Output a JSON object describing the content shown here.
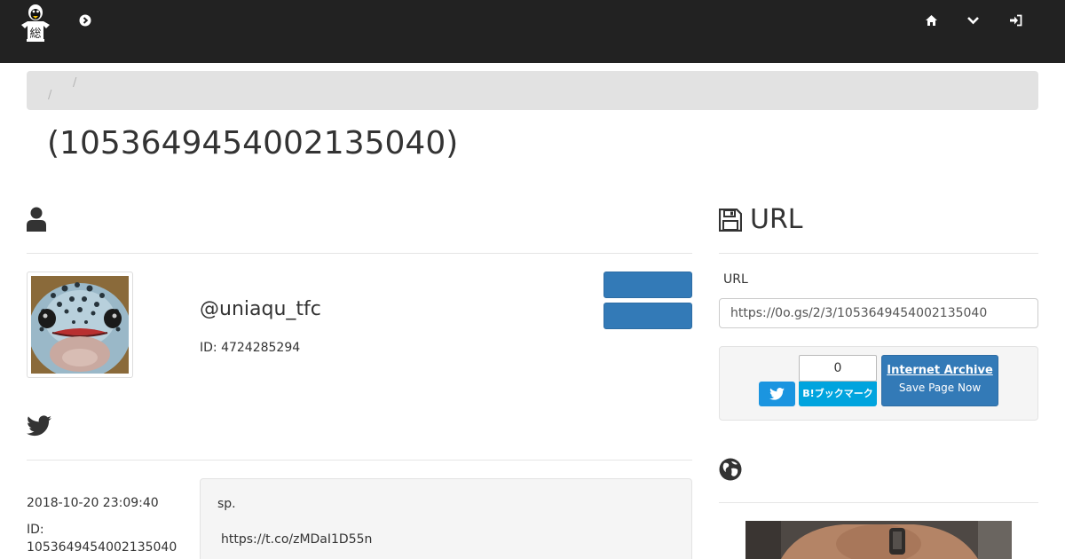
{
  "navbar": {
    "logo_name": "site-logo",
    "icons": [
      "chevron-circle-right-icon",
      "home-icon",
      "chevron-down-icon",
      "sign-in-icon"
    ]
  },
  "breadcrumb": {
    "separators": [
      "/",
      "/"
    ]
  },
  "page": {
    "title": "(1053649454002135040)"
  },
  "user": {
    "screen_name": "@uniaqu_tfc",
    "id_line": "ID: 4724285294"
  },
  "tweet": {
    "datetime": "2018-10-20 23:09:40",
    "id_label": "ID:",
    "id_value": "1053649454002135040",
    "text": "sp.",
    "link": "https://t.co/zMDaI1D55n"
  },
  "url_panel": {
    "heading": "URL",
    "label": "URL",
    "value": "https://0o.gs/2/3/1053649454002135040"
  },
  "share": {
    "hatena_count": "0",
    "hatena_label": "B!ブックマーク",
    "archive_title": "Internet Archive",
    "archive_sub": "Save Page Now"
  },
  "colors": {
    "navbar": "#222222",
    "primary_button": "#337ab7",
    "twitter_blue": "#1b95e0",
    "hatena_blue": "#00a4de",
    "breadcrumb_bg": "#e2e2e2"
  }
}
